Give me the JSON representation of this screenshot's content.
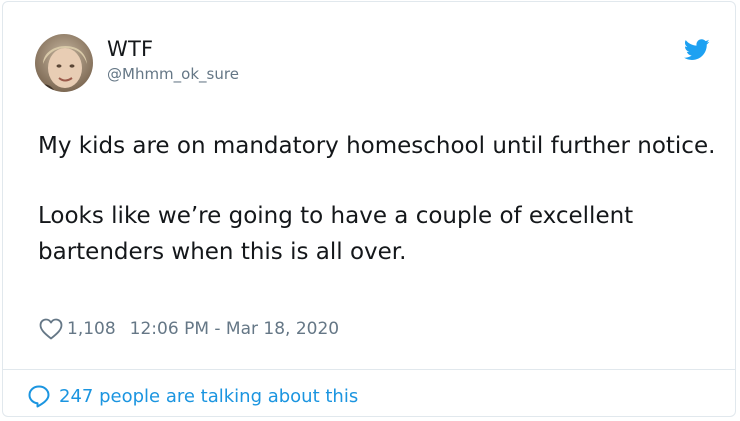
{
  "tweet": {
    "display_name": "WTF",
    "handle": "@Mhmm_ok_sure",
    "paragraphs": [
      "My kids are on mandatory homeschool until further notice.",
      "Looks like we’re going to have a couple of excellent bartenders when this is all over."
    ],
    "like_count": "1,108",
    "timestamp": "12:06 PM - Mar 18, 2020"
  },
  "footer": {
    "talking_text": "247 people are talking about this"
  },
  "icons": {
    "brand": "twitter-bird-icon",
    "like": "heart-icon",
    "reply": "speech-bubble-icon"
  },
  "colors": {
    "brand_blue": "#1da1f2",
    "link_blue": "#1b95e0",
    "muted_text": "#657786",
    "primary_text": "#14171a",
    "border": "#e1e8ed"
  }
}
